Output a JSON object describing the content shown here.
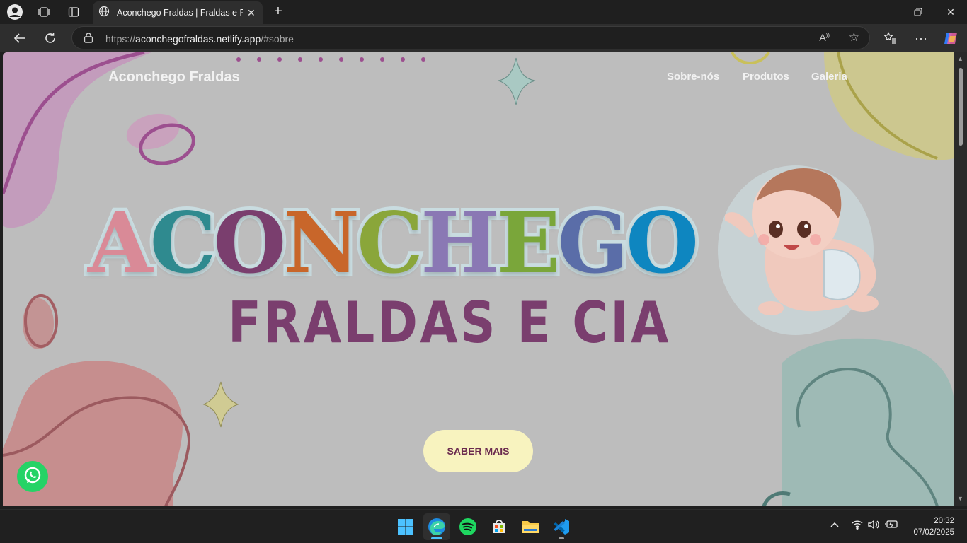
{
  "browser": {
    "tab_title": "Aconchego Fraldas | Fraldas e Pro",
    "url_host": "aconchegofraldas.netlify.app",
    "url_prefix": "https://",
    "url_suffix": "/#sobre"
  },
  "site": {
    "brand": "Aconchego Fraldas",
    "nav": [
      "Sobre-nós",
      "Produtos",
      "Galeria"
    ],
    "hero_word_letters": [
      "A",
      "C",
      "O",
      "N",
      "C",
      "H",
      "E",
      "G",
      "O"
    ],
    "hero_word_colors": [
      "#d98a97",
      "#2f8a8f",
      "#7a3e6e",
      "#c8662a",
      "#8aa63a",
      "#8a78b4",
      "#7aa63a",
      "#5a6da8",
      "#0e86c0"
    ],
    "hero_subtitle": "FRALDAS E CIA",
    "cta_label": "SABER MAIS"
  },
  "taskbar": {
    "time": "20:32",
    "date": "07/02/2025"
  }
}
